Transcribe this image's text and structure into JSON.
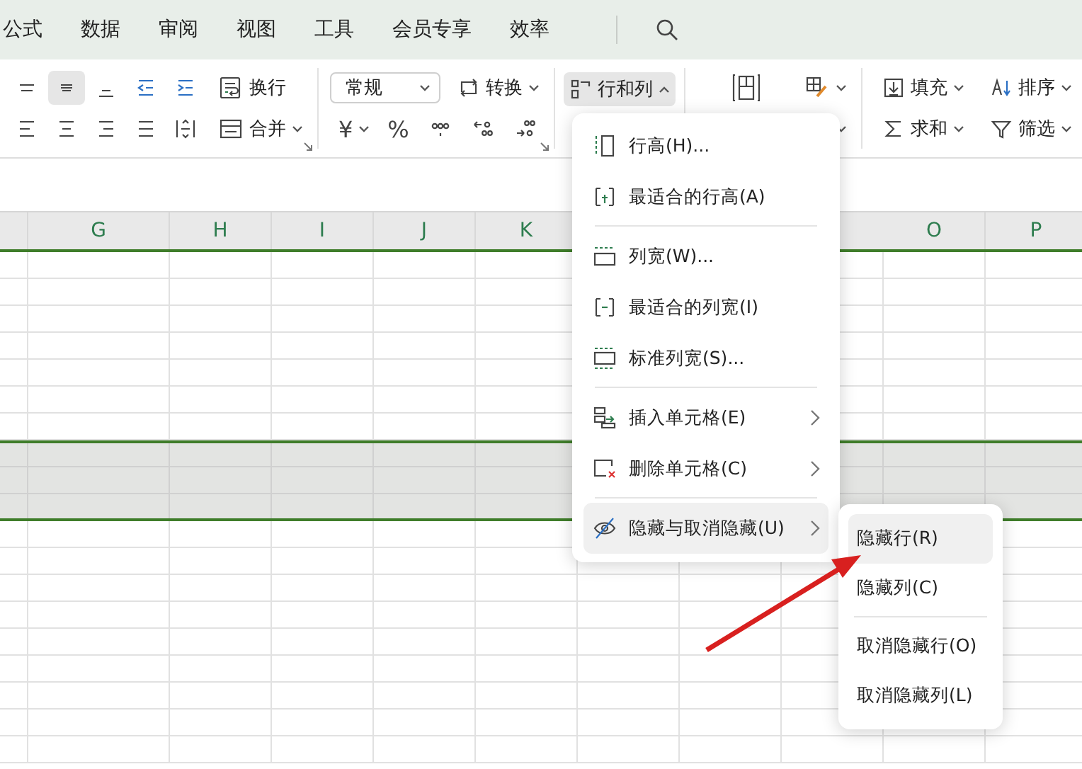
{
  "ribbon_tabs": [
    {
      "label": "公式"
    },
    {
      "label": "数据"
    },
    {
      "label": "审阅"
    },
    {
      "label": "视图"
    },
    {
      "label": "工具"
    },
    {
      "label": "会员专享"
    },
    {
      "label": "效率"
    }
  ],
  "toolbar": {
    "align_row_1": [
      {
        "kind": "align-top",
        "selected": false
      },
      {
        "kind": "align-middle",
        "selected": true
      },
      {
        "kind": "align-bottom",
        "selected": false
      },
      {
        "kind": "indent-decrease",
        "selected": false
      },
      {
        "kind": "indent-increase",
        "selected": false
      }
    ],
    "wrap_button": {
      "label": "换行"
    },
    "align_row_2": [
      {
        "kind": "align-left",
        "selected": false
      },
      {
        "kind": "align-center",
        "selected": false
      },
      {
        "kind": "align-right",
        "selected": false
      },
      {
        "kind": "justify",
        "selected": false
      },
      {
        "kind": "distribute",
        "selected": false
      }
    ],
    "merge_button": {
      "label": "合并"
    },
    "number_format": {
      "value": "常规"
    },
    "convert_button": {
      "label": "转换"
    },
    "number_buttons": [
      {
        "kind": "text",
        "label": "¥",
        "dropdown": true
      },
      {
        "kind": "text",
        "label": "%",
        "dropdown": false
      },
      {
        "kind": "thousands",
        "dropdown": false
      },
      {
        "kind": "decimal-add",
        "dropdown": false
      },
      {
        "kind": "decimal-remove",
        "dropdown": false
      }
    ],
    "rows_cols_button": {
      "label": "行和列",
      "expanded": true
    },
    "edit_row_1": [
      {
        "kind": "fill",
        "label": "填充"
      },
      {
        "kind": "sort",
        "label": "排序"
      }
    ],
    "edit_row_2": [
      {
        "kind": "sum",
        "label": "求和"
      },
      {
        "kind": "filter",
        "label": "筛选"
      }
    ]
  },
  "columns": [
    {
      "label": "G"
    },
    {
      "label": "H"
    },
    {
      "label": "I"
    },
    {
      "label": "J"
    },
    {
      "label": "K"
    },
    {
      "label": "O"
    },
    {
      "label": "P"
    }
  ],
  "rows": [
    {
      "selected": false
    },
    {
      "selected": false
    },
    {
      "selected": false
    },
    {
      "selected": false
    },
    {
      "selected": false
    },
    {
      "selected": false
    },
    {
      "selected": false
    },
    {
      "selected": true
    },
    {
      "selected": true
    },
    {
      "selected": true
    },
    {
      "selected": false
    },
    {
      "selected": false
    },
    {
      "selected": false
    },
    {
      "selected": false
    },
    {
      "selected": false
    },
    {
      "selected": false
    },
    {
      "selected": false
    },
    {
      "selected": false
    },
    {
      "selected": false
    }
  ],
  "context_menu": {
    "items": [
      {
        "kind": "row-height",
        "label": "行高(H)...",
        "submenu": false,
        "selected": false
      },
      {
        "kind": "fit-row-height",
        "label": "最适合的行高(A)",
        "submenu": false,
        "selected": false
      },
      {
        "kind": "separator"
      },
      {
        "kind": "col-width",
        "label": "列宽(W)...",
        "submenu": false,
        "selected": false
      },
      {
        "kind": "fit-col-width",
        "label": "最适合的列宽(I)",
        "submenu": false,
        "selected": false
      },
      {
        "kind": "std-col-width",
        "label": "标准列宽(S)...",
        "submenu": false,
        "selected": false
      },
      {
        "kind": "separator"
      },
      {
        "kind": "insert-cells",
        "label": "插入单元格(E)",
        "submenu": true,
        "selected": false
      },
      {
        "kind": "delete-cells",
        "label": "删除单元格(C)",
        "submenu": true,
        "selected": false
      },
      {
        "kind": "separator"
      },
      {
        "kind": "hide",
        "label": "隐藏与取消隐藏(U)",
        "submenu": true,
        "selected": true
      }
    ]
  },
  "submenu": {
    "items": [
      {
        "kind": "item",
        "label": "隐藏行(R)",
        "selected": true
      },
      {
        "kind": "item",
        "label": "隐藏列(C)",
        "selected": false
      },
      {
        "kind": "separator"
      },
      {
        "kind": "item",
        "label": "取消隐藏行(O)",
        "selected": false
      },
      {
        "kind": "item",
        "label": "取消隐藏列(L)",
        "selected": false
      }
    ]
  }
}
